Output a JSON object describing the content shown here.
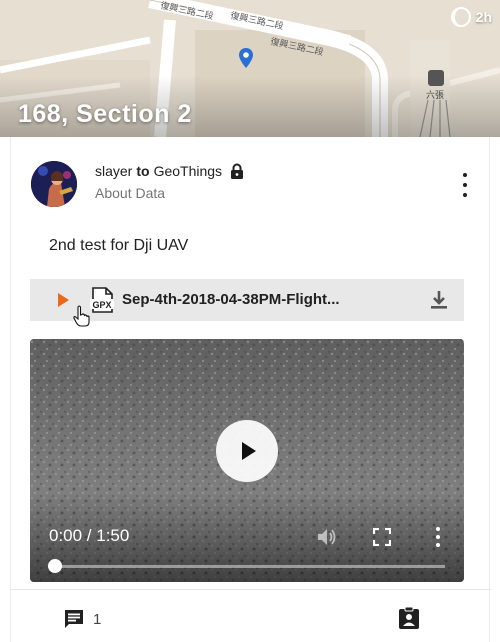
{
  "map": {
    "title": "168, Section 2",
    "timer": "2h",
    "station_label": "六張",
    "road_labels": [
      "復興三路二段",
      "復興三路二段",
      "復興三路二段"
    ]
  },
  "post": {
    "author": "slayer",
    "connector": "to",
    "group": "GeoThings",
    "category": "About Data",
    "text": "2nd test for Dji UAV",
    "visibility_icon": "lock-icon"
  },
  "attachment": {
    "type_label": "GPX",
    "file_name": "Sep-4th-2018-04-38PM-Flight...",
    "play_color": "#e8691b"
  },
  "video": {
    "time": "0:00 / 1:50",
    "progress": 0
  },
  "footer": {
    "comment_count": "1"
  }
}
